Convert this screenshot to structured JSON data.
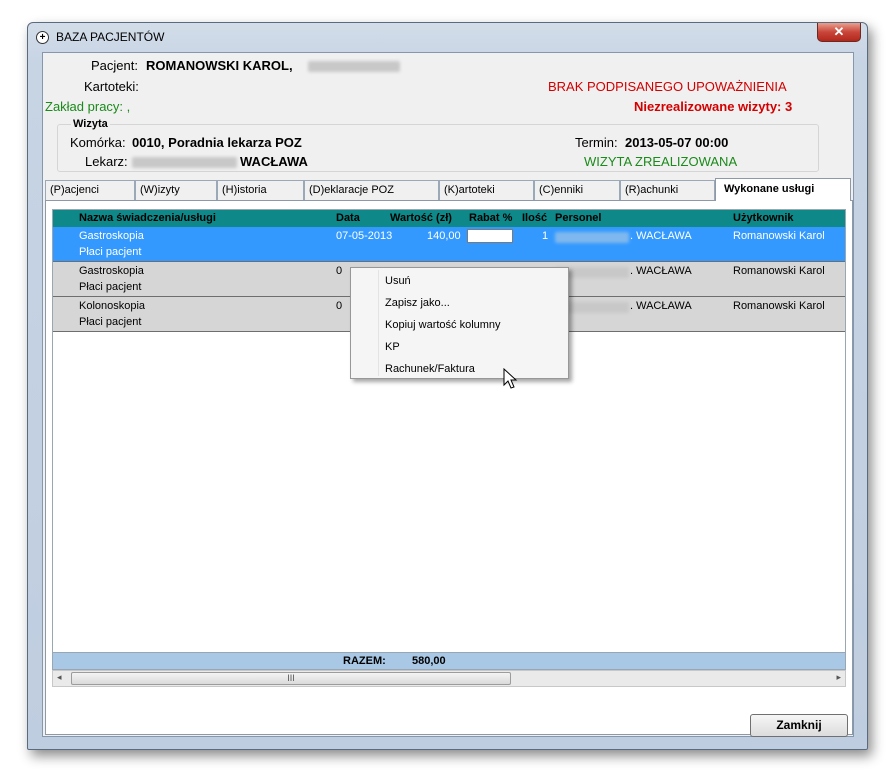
{
  "window": {
    "title": "BAZA PACJENTÓW",
    "close_glyph": "✕"
  },
  "patient": {
    "pacjent_label": "Pacjent:",
    "pacjent_name": "ROMANOWSKI KAROL,",
    "kartoteki_label": "Kartoteki:",
    "zaklad_label": "Zakład pracy: ,",
    "warning": "BRAK PODPISANEGO UPOWAŻNIENIA",
    "unrealized": "Niezrealizowane wizyty: 3"
  },
  "visit": {
    "group_title": "Wizyta",
    "komorka_label": "Komórka:",
    "komorka_value": "0010, Poradnia lekarza POZ",
    "lekarz_label": "Lekarz:",
    "lekarz_value": "WACŁAWA",
    "termin_label": "Termin:",
    "termin_value": "2013-05-07 00:00",
    "status": "WIZYTA ZREALIZOWANA"
  },
  "tabs": [
    {
      "label": "(P)acjenci"
    },
    {
      "label": "(W)izyty"
    },
    {
      "label": "(H)istoria"
    },
    {
      "label": "(D)eklaracje POZ"
    },
    {
      "label": "(K)artoteki"
    },
    {
      "label": "(C)enniki"
    },
    {
      "label": "(R)achunki"
    },
    {
      "label": "Wykonane usługi"
    }
  ],
  "grid": {
    "columns": [
      "Nazwa świadczenia/usługi",
      "Data",
      "Wartość (zł)",
      "Rabat %",
      "Ilość",
      "Personel",
      "Użytkownik"
    ],
    "rows": [
      {
        "name": "Gastroskopia",
        "payer": "Płaci pacjent",
        "date": "07-05-2013",
        "value": "140,00",
        "qty": "1",
        "personel": ". WACŁAWA",
        "user": "Romanowski Karol"
      },
      {
        "name": "Gastroskopia",
        "payer": "Płaci pacjent",
        "date": "0",
        "value": "",
        "qty": "",
        "personel": ". WACŁAWA",
        "user": "Romanowski Karol"
      },
      {
        "name": "Kolonoskopia",
        "payer": "Płaci pacjent",
        "date": "0",
        "value": "",
        "qty": "",
        "personel": ". WACŁAWA",
        "user": "Romanowski Karol"
      }
    ],
    "totals_label": "RAZEM:",
    "totals_value": "580,00"
  },
  "context_menu": {
    "items": [
      "Usuń",
      "Zapisz jako...",
      "Kopiuj wartość kolumny",
      "KP",
      "Rachunek/Faktura"
    ]
  },
  "scrollbar": {
    "left_arrow": "◂",
    "right_arrow": "▸",
    "grip": "III"
  },
  "buttons": {
    "close_label": "Zamknij"
  },
  "colors": {
    "header_bg": "#0e8888",
    "selected_row": "#3399ff",
    "warning": "#d40000",
    "status_green": "#1a8a1a"
  }
}
